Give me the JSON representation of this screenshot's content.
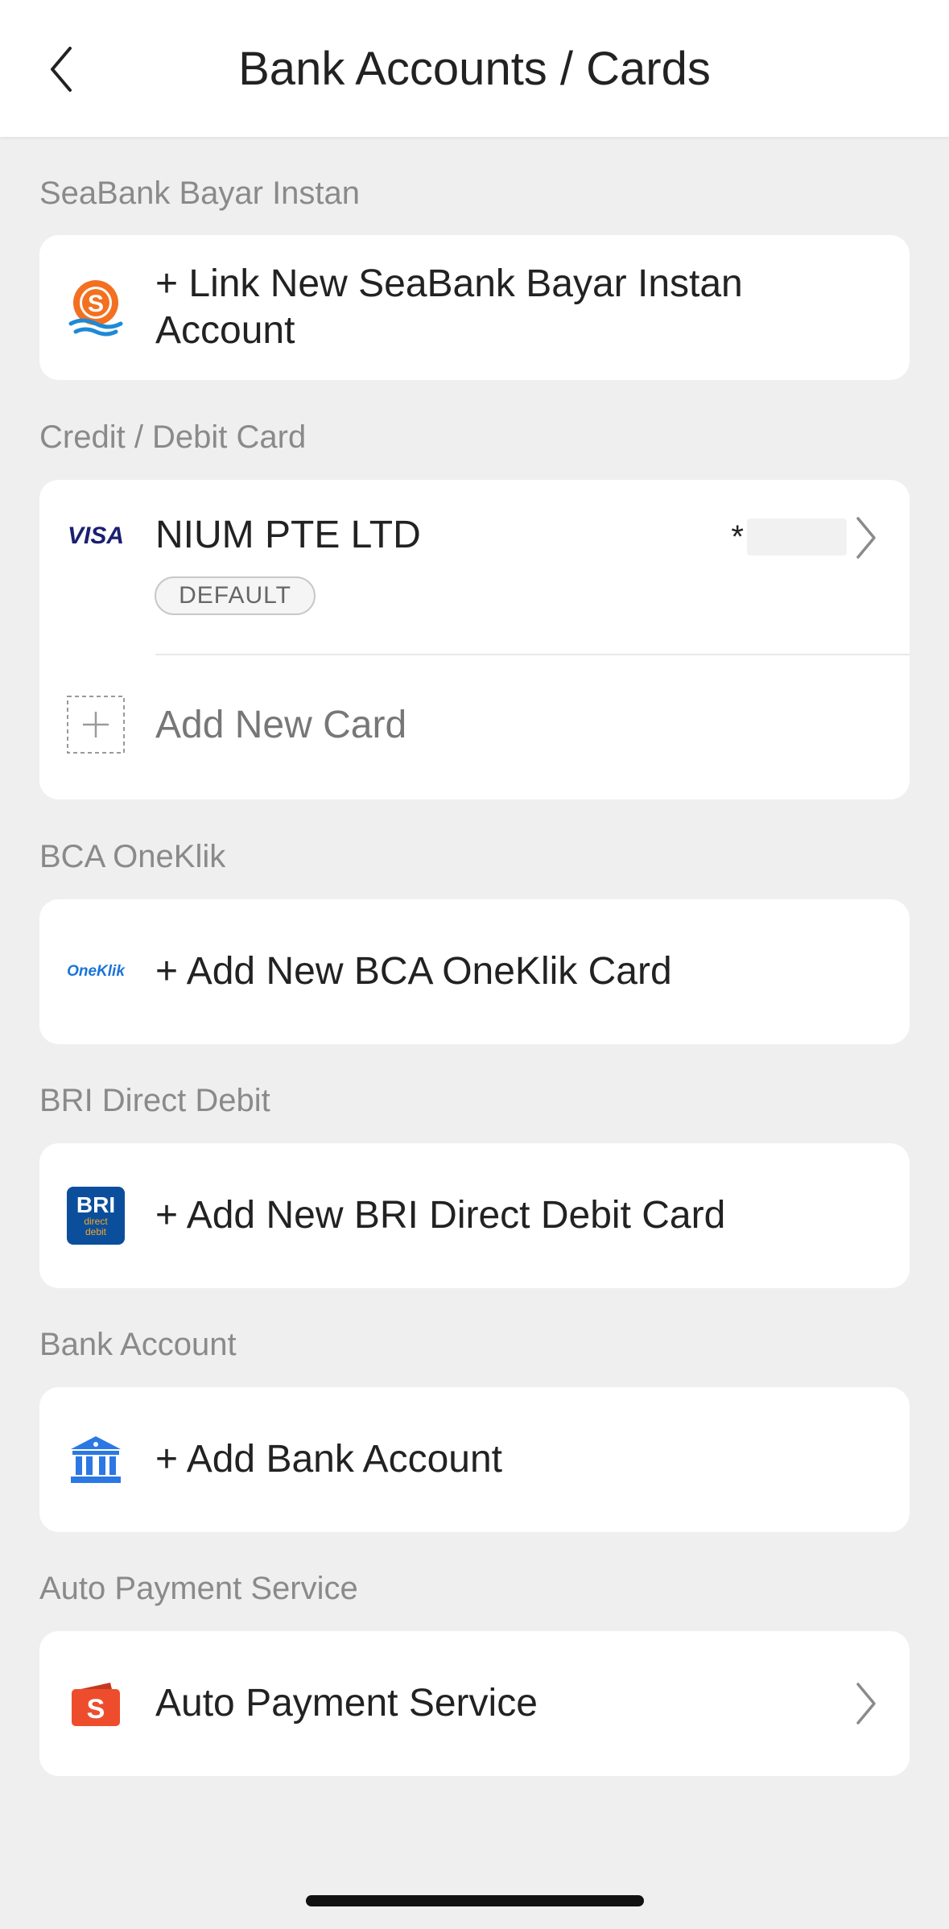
{
  "header": {
    "title": "Bank Accounts / Cards",
    "back_icon": "chevron-left-icon"
  },
  "sections": {
    "seabank": {
      "label": "SeaBank Bayar Instan",
      "item_text": "+ Link New SeaBank Bayar Instan Account",
      "icon": "seabank-logo-icon",
      "brand_color": "#ee4d2d"
    },
    "credit_debit": {
      "label": "Credit / Debit Card",
      "card_name": "NIUM PTE LTD",
      "card_brand": "VISA",
      "masked_number": "*",
      "default_badge": "DEFAULT",
      "add_card_text": "Add New Card",
      "visa_color": "#1a1f71"
    },
    "oneklik": {
      "label": "BCA OneKlik",
      "item_text": "+ Add New BCA OneKlik Card",
      "logo_text": "OneKlik",
      "brand_color": "#1a73d9"
    },
    "bri": {
      "label": "BRI Direct Debit",
      "item_text": "+ Add New BRI Direct Debit Card",
      "logo_main": "BRI",
      "logo_sub": "direct debit",
      "brand_color": "#0b4f9c"
    },
    "bank_account": {
      "label": "Bank Account",
      "item_text": "+ Add Bank Account",
      "icon": "bank-building-icon",
      "brand_color": "#2b78e4"
    },
    "auto_payment": {
      "label": "Auto Payment Service",
      "item_text": "Auto Payment Service",
      "icon": "shopee-bag-icon",
      "brand_color": "#ee4d2d"
    }
  }
}
